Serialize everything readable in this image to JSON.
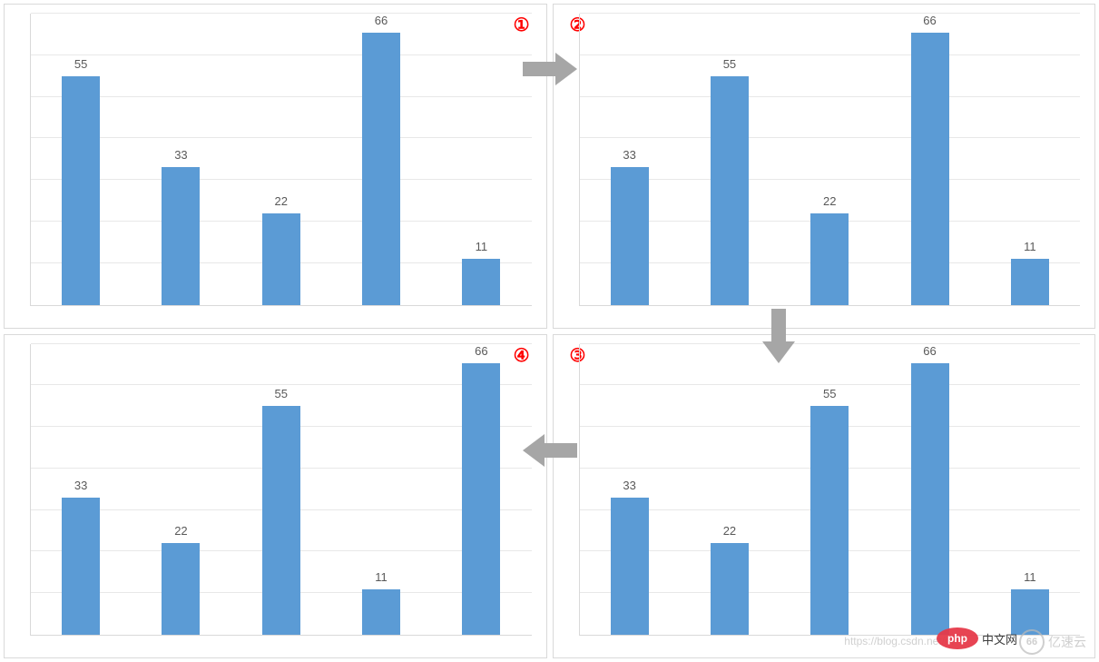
{
  "ymax": 70,
  "gridlines_at": [
    10,
    20,
    30,
    40,
    50,
    60,
    70
  ],
  "bar_color": "#5b9bd5",
  "panels": [
    {
      "id": 1,
      "badge": "①",
      "badge_side": "right",
      "values": [
        55,
        33,
        22,
        66,
        11
      ]
    },
    {
      "id": 2,
      "badge": "②",
      "badge_side": "left",
      "values": [
        33,
        55,
        22,
        66,
        11
      ]
    },
    {
      "id": 4,
      "badge": "④",
      "badge_side": "right",
      "values": [
        33,
        22,
        55,
        11,
        66
      ]
    },
    {
      "id": 3,
      "badge": "③",
      "badge_side": "left",
      "values": [
        33,
        22,
        55,
        66,
        11
      ]
    }
  ],
  "arrows": [
    {
      "name": "arrow-1-to-2",
      "dir": "right"
    },
    {
      "name": "arrow-2-to-3",
      "dir": "down"
    },
    {
      "name": "arrow-3-to-4",
      "dir": "left"
    }
  ],
  "watermarks": {
    "php_badge": "php",
    "php_text": "中文网",
    "ys_badge": "66",
    "ys_text": "亿速云",
    "faint_url": "https://blog.csdn.net/m"
  },
  "chart_data": [
    {
      "type": "bar",
      "panel": 1,
      "categories": [
        "",
        "",
        "",
        "",
        ""
      ],
      "values": [
        55,
        33,
        22,
        66,
        11
      ],
      "ylim": [
        0,
        70
      ],
      "title": "",
      "xlabel": "",
      "ylabel": ""
    },
    {
      "type": "bar",
      "panel": 2,
      "categories": [
        "",
        "",
        "",
        "",
        ""
      ],
      "values": [
        33,
        55,
        22,
        66,
        11
      ],
      "ylim": [
        0,
        70
      ],
      "title": "",
      "xlabel": "",
      "ylabel": ""
    },
    {
      "type": "bar",
      "panel": 3,
      "categories": [
        "",
        "",
        "",
        "",
        ""
      ],
      "values": [
        33,
        22,
        55,
        66,
        11
      ],
      "ylim": [
        0,
        70
      ],
      "title": "",
      "xlabel": "",
      "ylabel": ""
    },
    {
      "type": "bar",
      "panel": 4,
      "categories": [
        "",
        "",
        "",
        "",
        ""
      ],
      "values": [
        33,
        22,
        55,
        11,
        66
      ],
      "ylim": [
        0,
        70
      ],
      "title": "",
      "xlabel": "",
      "ylabel": ""
    }
  ]
}
